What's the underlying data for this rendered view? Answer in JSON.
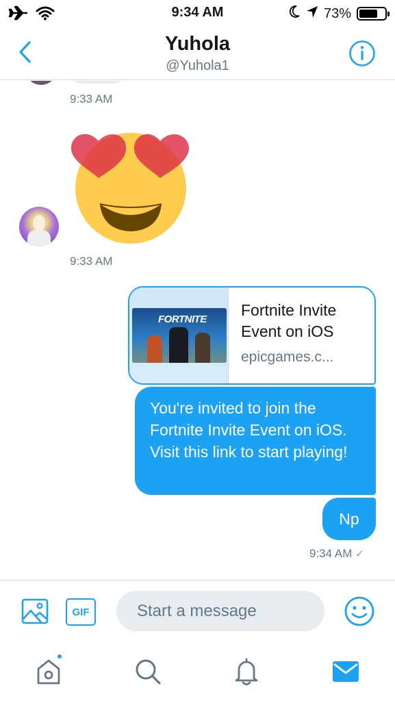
{
  "status_bar": {
    "time": "9:34 AM",
    "battery_text": "73%",
    "battery_level": 0.73,
    "icons": [
      "airplane-icon",
      "wifi-icon",
      "moon-icon",
      "location-arrow-icon",
      "battery-icon"
    ]
  },
  "header": {
    "title": "Yuhola",
    "handle": "@Yuhola1",
    "icons": [
      "back-chevron-icon",
      "info-icon"
    ]
  },
  "messages": {
    "first_timestamp": "9:33 AM",
    "emoji_name": "heart-eyes-emoji",
    "emoji_timestamp": "9:33 AM",
    "link_card": {
      "thumb_logo": "FORTNITE",
      "title": "Fortnite Invite Event on iOS",
      "domain": "epicgames.c..."
    },
    "invite_text": "You're invited to join the Fortnite Invite Event on iOS. Visit this link to start playing!",
    "reply_text": "Np",
    "last_timestamp": "9:34 AM",
    "read_mark": "✓"
  },
  "composer": {
    "placeholder": "Start a message",
    "gif_label": "GIF",
    "icons": [
      "image-icon",
      "gif-icon",
      "emoji-smile-icon"
    ]
  },
  "tabbar": {
    "items": [
      "home",
      "search",
      "notifications",
      "messages"
    ],
    "active": "messages",
    "home_has_new": true
  },
  "colors": {
    "accent": "#1da1f2",
    "text_primary": "#14171a",
    "text_secondary": "#657786",
    "incoming_bubble": "#e6ecf0",
    "divider": "#d8dde1"
  }
}
